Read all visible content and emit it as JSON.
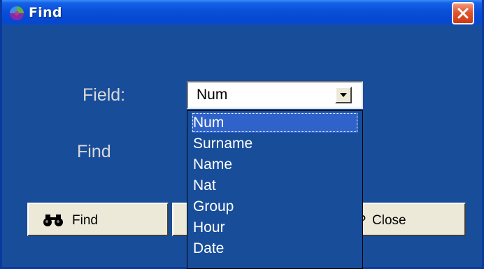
{
  "window": {
    "title": "Find",
    "accent": "#0548d2",
    "background": "#184d9a",
    "close_color": "#e0552f"
  },
  "form": {
    "field_label": "Field:",
    "find_label": "Find",
    "field_value": "Num"
  },
  "dropdown": {
    "options": [
      "Num",
      "Surname",
      "Name",
      "Nat",
      "Group",
      "Hour",
      "Date"
    ],
    "selected": "Num"
  },
  "buttons": {
    "find_label": "Find",
    "find_icon": "binoculars-icon",
    "close_label": "Close",
    "close_icon": "question-icon"
  }
}
